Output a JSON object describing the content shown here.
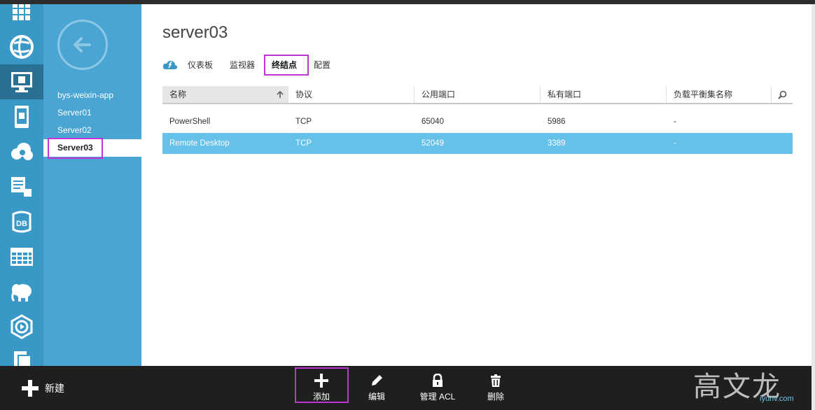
{
  "page": {
    "title": "server03",
    "accent_color": "#3a98c7",
    "selected_row_color": "#66c1e8"
  },
  "rail": {
    "items": [
      {
        "icon": "grid-icon"
      },
      {
        "icon": "globe-icon"
      },
      {
        "icon": "monitor-icon"
      },
      {
        "icon": "mobile-icon"
      },
      {
        "icon": "cloud-gear-icon"
      },
      {
        "icon": "document-icon"
      },
      {
        "icon": "database-icon",
        "label": "DB"
      },
      {
        "icon": "table-icon"
      },
      {
        "icon": "elephant-icon"
      },
      {
        "icon": "media-icon"
      },
      {
        "icon": "file-icon"
      }
    ]
  },
  "subnav": {
    "items": [
      "bys-weixin-app",
      "Server01",
      "Server02",
      "Server03"
    ],
    "active": "Server03"
  },
  "tabs": {
    "items": [
      "仪表板",
      "监视器",
      "终结点",
      "配置"
    ],
    "active": "终结点"
  },
  "table": {
    "columns": [
      "名称",
      "协议",
      "公用端口",
      "私有端口",
      "负载平衡集名称"
    ],
    "rows": [
      {
        "name": "PowerShell",
        "protocol": "TCP",
        "public_port": "65040",
        "private_port": "5986",
        "lb_set": "-"
      },
      {
        "name": "Remote Desktop",
        "protocol": "TCP",
        "public_port": "52049",
        "private_port": "3389",
        "lb_set": "-"
      }
    ],
    "selected_row": 1
  },
  "commandbar": {
    "new_label": "新建",
    "add_label": "添加",
    "edit_label": "编辑",
    "acl_label": "管理 ACL",
    "delete_label": "删除"
  },
  "watermark": {
    "text": "高文龙",
    "sub": "iyunv.com"
  }
}
